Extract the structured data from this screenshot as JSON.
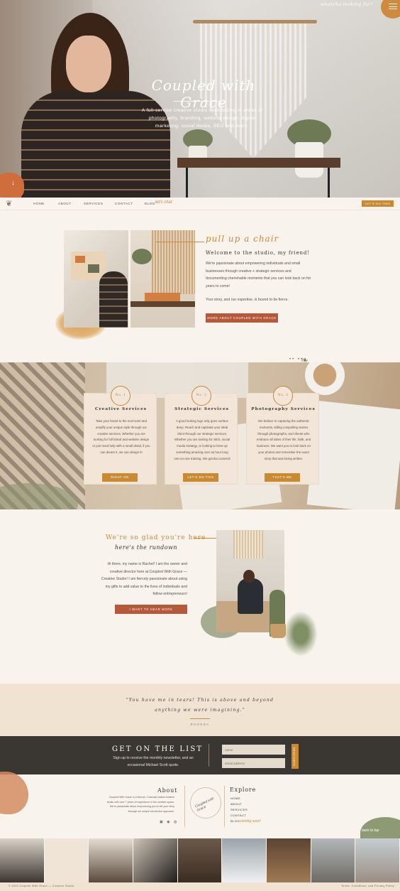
{
  "hero": {
    "logo_text": "Coupled with Grace",
    "tagline": "A full-service creative studio specializing in areas of photography, branding, website design, digital marketing, social media, SEO and more.",
    "looking_text": "whatcha looking for?",
    "menu_icon": "hamburger-icon",
    "arrow_icon": "arrow-down-icon"
  },
  "nav": {
    "items": [
      "HOME",
      "ABOUT",
      "SERVICES",
      "CONTACT",
      "BLOG"
    ],
    "script": "let's chat",
    "cta": "LET'S DO THIS"
  },
  "welcome": {
    "script": "pull up a chair",
    "title": "Welcome to the studio, my friend!",
    "body": "We're passionate about empowering individuals and small businesses through creative + strategic services and documenting cherishable moments that you can look back on for years to come!",
    "body2": "Your story, and our expertise, is bound to be fierce.",
    "button": "MORE ABOUT COUPLED WITH GRACE"
  },
  "services": [
    {
      "num": "No. 1",
      "title": "Creative Services",
      "body": "Take your brand to the next level and amplify your unique style through our creative services. Whether you are looking for full brand and website design or just need help with a small detail, if you can dream it, we can design it!",
      "button": "RIGHT ON"
    },
    {
      "num": "No. 2",
      "title": "Strategic Services",
      "body": "A good looking logo only goes surface deep. Reach and captivate your ideal client through our strategic services. Whether you are looking for SEO, social media strategy, or looking to brew up something amazing over an hour long one-on-one training. We gotcha covered!",
      "button": "LET'S DO THIS"
    },
    {
      "num": "No. 3",
      "title": "Photography Services",
      "body": "We believe in capturing the authentic moments, telling compelling stories through photographs, and clients who embrace all sides of their life, faith, and business. We want you to look back on your photos and remember the exact story that was being written.",
      "button": "THAT'S ME"
    }
  ],
  "glad": {
    "title": "We're so glad you're here",
    "script": "here's the rundown",
    "body": "Hi there, my name is Rachel! I am the owner and creative director here at Coupled With Grace — Creative Studio! I am fiercely passionate about using my gifts to add value to the lives of individuals and fellow entrepreneurs!",
    "button": "I WANT TO HEAR MORE"
  },
  "testimonial": {
    "quote": "\"You have me in tears! This is above and beyond anything we were imagining.\"",
    "name": "RHONDA"
  },
  "newsletter": {
    "title": "GET ON THE LIST",
    "sub": "Sign up to receive the monthly newsletter, and an occasional Michael Scott quote.",
    "name_placeholder": "name",
    "email_placeholder": "email address",
    "button": "SUBSCRIBE"
  },
  "footer": {
    "about_title": "About",
    "about_body": "Coupled With Grace is a Denver, Colorado based creative studio with over 7 years of experience in the creative space. We're passionate about empowering you to tell your story through our unique full-service approach.",
    "logo_text": "Coupled with Grace",
    "explore_title": "Explore",
    "links": [
      "HOME",
      "ABOUT",
      "SERVICES",
      "CONTACT",
      "BLOG"
    ],
    "script": "coming soon!",
    "back_top": "back to top",
    "social_icons": [
      "instagram-icon",
      "pinterest-icon",
      "facebook-icon"
    ],
    "social_glyphs": "▣ ◉ ◍",
    "copyright": "© 2019 Coupled With Grace — Creative Studio",
    "legal": "Terms, Conditions, and Privacy Policy"
  },
  "colors": {
    "accent_gold": "#c98a32",
    "accent_rust": "#b5593a",
    "cream": "#f8f3ec",
    "dark": "#3a3631"
  }
}
